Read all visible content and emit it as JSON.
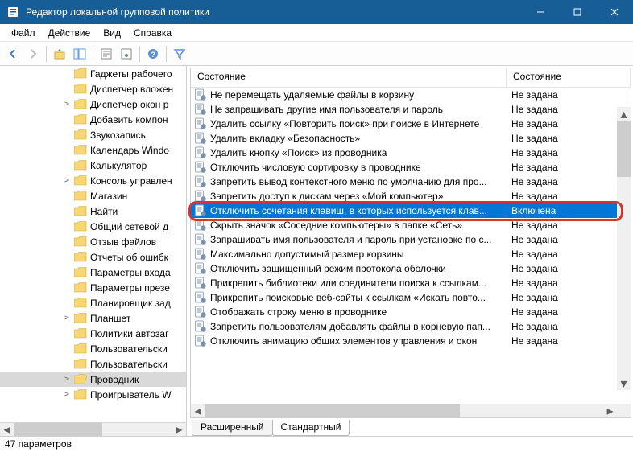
{
  "titlebar": {
    "title": "Редактор локальной групповой политики"
  },
  "menubar": [
    "Файл",
    "Действие",
    "Вид",
    "Справка"
  ],
  "columns": {
    "c1": "Состояние",
    "c2": "Состояние"
  },
  "tree": [
    {
      "label": "Гаджеты рабочего",
      "depth": 1,
      "exp": ""
    },
    {
      "label": "Диспетчер вложен",
      "depth": 1,
      "exp": ""
    },
    {
      "label": "Диспетчер окон р",
      "depth": 1,
      "exp": ">"
    },
    {
      "label": "Добавить компон",
      "depth": 1,
      "exp": ""
    },
    {
      "label": "Звукозапись",
      "depth": 1,
      "exp": ""
    },
    {
      "label": "Календарь Windo",
      "depth": 1,
      "exp": ""
    },
    {
      "label": "Калькулятор",
      "depth": 1,
      "exp": ""
    },
    {
      "label": "Консоль управлен",
      "depth": 1,
      "exp": ">"
    },
    {
      "label": "Магазин",
      "depth": 1,
      "exp": ""
    },
    {
      "label": "Найти",
      "depth": 1,
      "exp": ""
    },
    {
      "label": "Общий сетевой д",
      "depth": 1,
      "exp": ""
    },
    {
      "label": "Отзыв файлов",
      "depth": 1,
      "exp": ""
    },
    {
      "label": "Отчеты об ошибк",
      "depth": 1,
      "exp": ""
    },
    {
      "label": "Параметры входа",
      "depth": 1,
      "exp": ""
    },
    {
      "label": "Параметры презе",
      "depth": 1,
      "exp": ""
    },
    {
      "label": "Планировщик зад",
      "depth": 1,
      "exp": ""
    },
    {
      "label": "Планшет",
      "depth": 1,
      "exp": ">"
    },
    {
      "label": "Политики автозаг",
      "depth": 1,
      "exp": ""
    },
    {
      "label": "Пользовательски",
      "depth": 1,
      "exp": ""
    },
    {
      "label": "Пользовательски",
      "depth": 1,
      "exp": ""
    },
    {
      "label": "Проводник",
      "depth": 1,
      "exp": ">",
      "selected": true,
      "open": true
    },
    {
      "label": "Проигрыватель W",
      "depth": 1,
      "exp": ">"
    }
  ],
  "list": [
    {
      "name": "Не перемещать удаляемые файлы в корзину",
      "state": "Не задана"
    },
    {
      "name": "Не запрашивать другие имя пользователя и пароль",
      "state": "Не задана"
    },
    {
      "name": "Удалить ссылку «Повторить поиск» при поиске в Интернете",
      "state": "Не задана"
    },
    {
      "name": "Удалить вкладку «Безопасность»",
      "state": "Не задана"
    },
    {
      "name": "Удалить кнопку «Поиск» из проводника",
      "state": "Не задана"
    },
    {
      "name": "Отключить числовую сортировку в проводнике",
      "state": "Не задана"
    },
    {
      "name": "Запретить вывод контекстного меню по умолчанию для про...",
      "state": "Не задана"
    },
    {
      "name": "Запретить доступ к дискам через «Мой компьютер»",
      "state": "Не задана"
    },
    {
      "name": "Отключить сочетания клавиш, в которых используется клав...",
      "state": "Включена",
      "selected": true
    },
    {
      "name": "Скрыть значок «Соседние компьютеры» в папке «Сеть»",
      "state": "Не задана"
    },
    {
      "name": "Запрашивать имя пользователя и пароль при установке по с...",
      "state": "Не задана"
    },
    {
      "name": "Максимально допустимый размер корзины",
      "state": "Не задана"
    },
    {
      "name": "Отключить защищенный режим протокола оболочки",
      "state": "Не задана"
    },
    {
      "name": "Прикрепить библиотеки или соединители поиска к ссылкам...",
      "state": "Не задана"
    },
    {
      "name": "Прикрепить поисковые веб-сайты к ссылкам «Искать повто...",
      "state": "Не задана"
    },
    {
      "name": "Отображать строку меню в проводнике",
      "state": "Не задана"
    },
    {
      "name": "Запретить пользователям добавлять файлы в корневую пап...",
      "state": "Не задана"
    },
    {
      "name": "Отключить анимацию общих элементов управления и окон",
      "state": "Не задана"
    }
  ],
  "tabs": {
    "extended": "Расширенный",
    "standard": "Стандартный"
  },
  "statusbar": "47 параметров"
}
